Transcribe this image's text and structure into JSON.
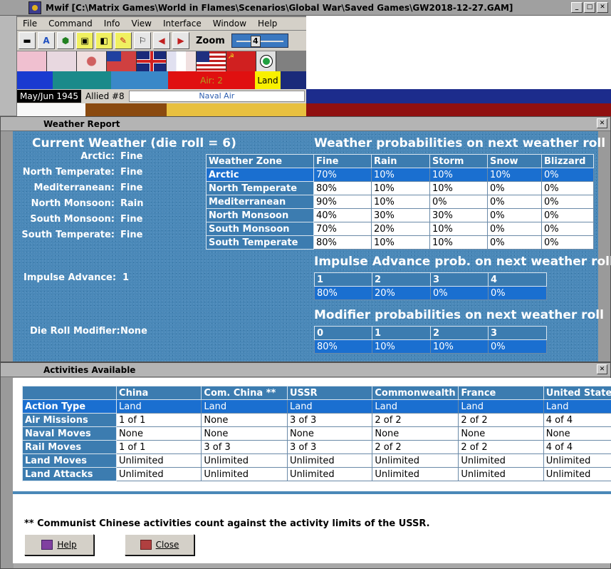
{
  "window": {
    "title": "Mwif [C:\\Matrix Games\\World in Flames\\Scenarios\\Global War\\Saved Games\\GW2018-12-27.GAM]",
    "buttons": [
      "_",
      "□",
      "✕"
    ]
  },
  "menu": [
    "File",
    "Command",
    "Info",
    "View",
    "Interface",
    "Window",
    "Help"
  ],
  "toolbar": {
    "zoom_label": "Zoom",
    "zoom_value": "4"
  },
  "strip": {
    "air": "Air: 2",
    "land": "Land"
  },
  "status": {
    "date": "May/Jun 1945",
    "impulse": "Allied #8",
    "mode": "Naval Air"
  },
  "weather": {
    "panel_title": "Weather Report",
    "current_heading": "Current Weather (die roll = 6)",
    "zones": [
      {
        "label": "Arctic:",
        "value": "Fine"
      },
      {
        "label": "North Temperate:",
        "value": "Fine"
      },
      {
        "label": "Mediterranean:",
        "value": "Fine"
      },
      {
        "label": "North Monsoon:",
        "value": "Rain"
      },
      {
        "label": "South Monsoon:",
        "value": "Fine"
      },
      {
        "label": "South Temperate:",
        "value": "Fine"
      }
    ],
    "impulse_label": "Impulse Advance:",
    "impulse_value": "1",
    "modifier_label": "Die Roll Modifier:",
    "modifier_value": "None",
    "prob_heading": "Weather probabilities on next weather roll",
    "prob_table": {
      "headers": [
        "Weather Zone",
        "Fine",
        "Rain",
        "Storm",
        "Snow",
        "Blizzard"
      ],
      "rows": [
        [
          "Arctic",
          "70%",
          "10%",
          "10%",
          "10%",
          "0%"
        ],
        [
          "North Temperate",
          "80%",
          "10%",
          "10%",
          "0%",
          "0%"
        ],
        [
          "Mediterranean",
          "90%",
          "10%",
          "0%",
          "0%",
          "0%"
        ],
        [
          "North Monsoon",
          "40%",
          "30%",
          "30%",
          "0%",
          "0%"
        ],
        [
          "South Monsoon",
          "70%",
          "20%",
          "10%",
          "0%",
          "0%"
        ],
        [
          "South Temperate",
          "80%",
          "10%",
          "10%",
          "0%",
          "0%"
        ]
      ]
    },
    "impulse_heading": "Impulse Advance prob. on next weather roll",
    "impulse_table": {
      "headers": [
        "1",
        "2",
        "3",
        "4"
      ],
      "values": [
        "80%",
        "20%",
        "0%",
        "0%"
      ]
    },
    "modifier_heading": "Modifier probabilities on next weather roll",
    "modifier_table": {
      "headers": [
        "0",
        "1",
        "2",
        "3"
      ],
      "values": [
        "80%",
        "10%",
        "10%",
        "0%"
      ]
    }
  },
  "activities": {
    "panel_title": "Activities Available",
    "headers": [
      "",
      "China",
      "Com. China **",
      "USSR",
      "Commonwealth",
      "France",
      "United States"
    ],
    "rows": [
      [
        "Action Type",
        "Land",
        "Land",
        "Land",
        "Land",
        "Land",
        "Land"
      ],
      [
        "Air Missions",
        "1 of 1",
        "None",
        "3 of 3",
        "2 of 2",
        "2 of 2",
        "4 of 4"
      ],
      [
        "Naval Moves",
        "None",
        "None",
        "None",
        "None",
        "None",
        "None"
      ],
      [
        "Rail Moves",
        "1 of 1",
        "3 of 3",
        "3 of 3",
        "2 of 2",
        "2 of 2",
        "4 of 4"
      ],
      [
        "Land Moves",
        "Unlimited",
        "Unlimited",
        "Unlimited",
        "Unlimited",
        "Unlimited",
        "Unlimited"
      ],
      [
        "Land Attacks",
        "Unlimited",
        "Unlimited",
        "Unlimited",
        "Unlimited",
        "Unlimited",
        "Unlimited"
      ]
    ],
    "footnote": "** Communist Chinese activities count against the activity limits of the USSR.",
    "help_label": "Help",
    "close_label": "Close"
  },
  "colors": {
    "denim": "#4a88b8",
    "header_cell": "#3c7cb0",
    "selected_row": "#1a6fd0"
  }
}
